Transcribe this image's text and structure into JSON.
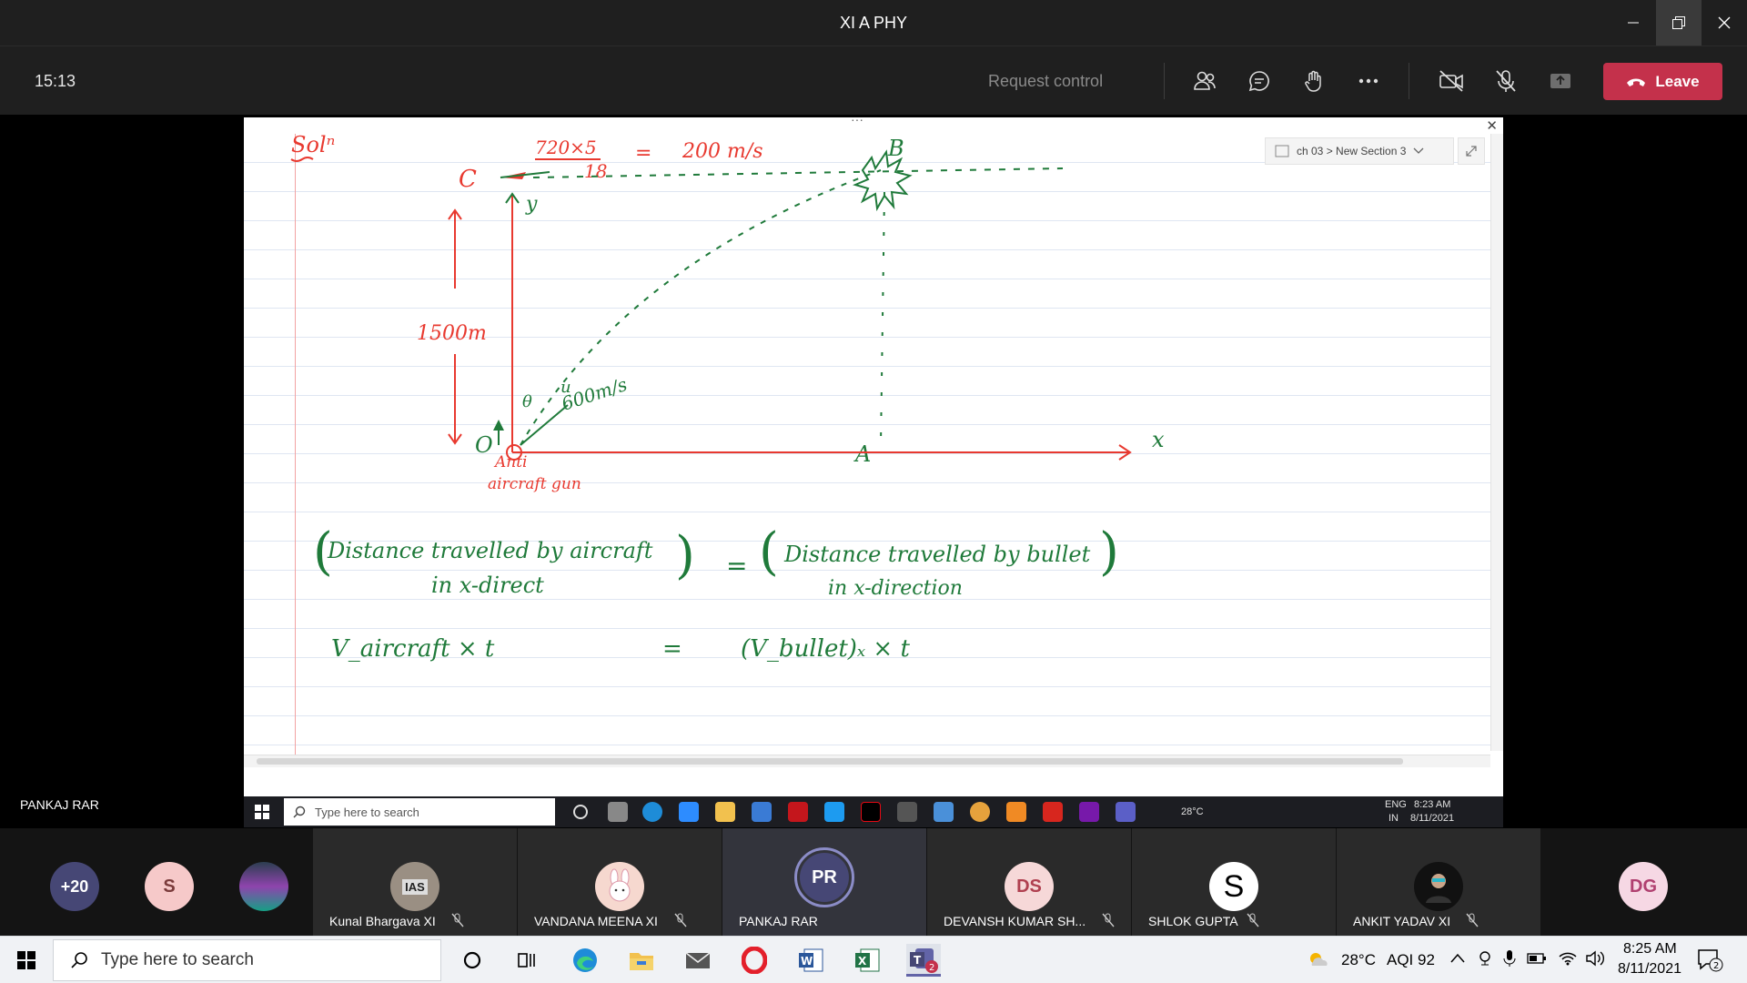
{
  "window": {
    "title": "XI A PHY"
  },
  "toolbar": {
    "timer": "15:13",
    "request_control": "Request control",
    "leave_label": "Leave"
  },
  "notebook": {
    "breadcrumb": "ch 03 > New Section 3",
    "notes": {
      "solution": "Solⁿ",
      "speed_frac_num": "720×5",
      "speed_frac_den": "18",
      "speed_eq": "=",
      "speed_result": "200 m/s",
      "label_c": "C",
      "label_b": "B",
      "label_y": "y",
      "height": "1500m",
      "label_o": "O",
      "label_a": "A",
      "label_x": "x",
      "label_u": "u",
      "bullet_speed": "600m/s",
      "theta": "θ",
      "gun_line1": "Anti",
      "gun_line2": "aircraft gun",
      "eq1_left_line1": "Distance travelled by aircraft",
      "eq1_left_line2": "in x-direct",
      "eq1_equals": "=",
      "eq1_right_line1": "Distance travelled by bullet",
      "eq1_right_line2": "in x-direction",
      "eq2_left": "V_aircraft × t",
      "eq2_equals": "=",
      "eq2_right": "(V_bullet)ₓ × t"
    }
  },
  "presenter": {
    "name": "PANKAJ RAR"
  },
  "inner_taskbar": {
    "search_placeholder": "Type here to search",
    "weather": "28°C",
    "lang_line1": "ENG",
    "lang_line2": "IN",
    "time": "8:23 AM",
    "date": "8/11/2021"
  },
  "participants": {
    "overflow": "+20",
    "people": [
      {
        "initials": "S",
        "name": ""
      },
      {
        "initials": "",
        "name": ""
      },
      {
        "initials": "IAS",
        "name": "Kunal Bhargava XI"
      },
      {
        "initials": "",
        "name": "VANDANA MEENA XI"
      },
      {
        "initials": "PR",
        "name": "PANKAJ RAR"
      },
      {
        "initials": "DS",
        "name": "DEVANSH KUMAR SH..."
      },
      {
        "initials": "S",
        "name": "SHLOK GUPTA"
      },
      {
        "initials": "",
        "name": "ANKIT YADAV XI"
      },
      {
        "initials": "DG",
        "name": ""
      }
    ]
  },
  "taskbar": {
    "search_placeholder": "Type here to search",
    "weather": "28°C",
    "aqi": "AQI 92",
    "time": "8:25 AM",
    "date": "8/11/2021",
    "notifications": "2",
    "teams_badge": "2"
  },
  "colors": {
    "leave": "#c4314b",
    "ink_red": "#e8392f",
    "ink_green": "#1f7a3a",
    "accent_teams": "#6264a7"
  }
}
